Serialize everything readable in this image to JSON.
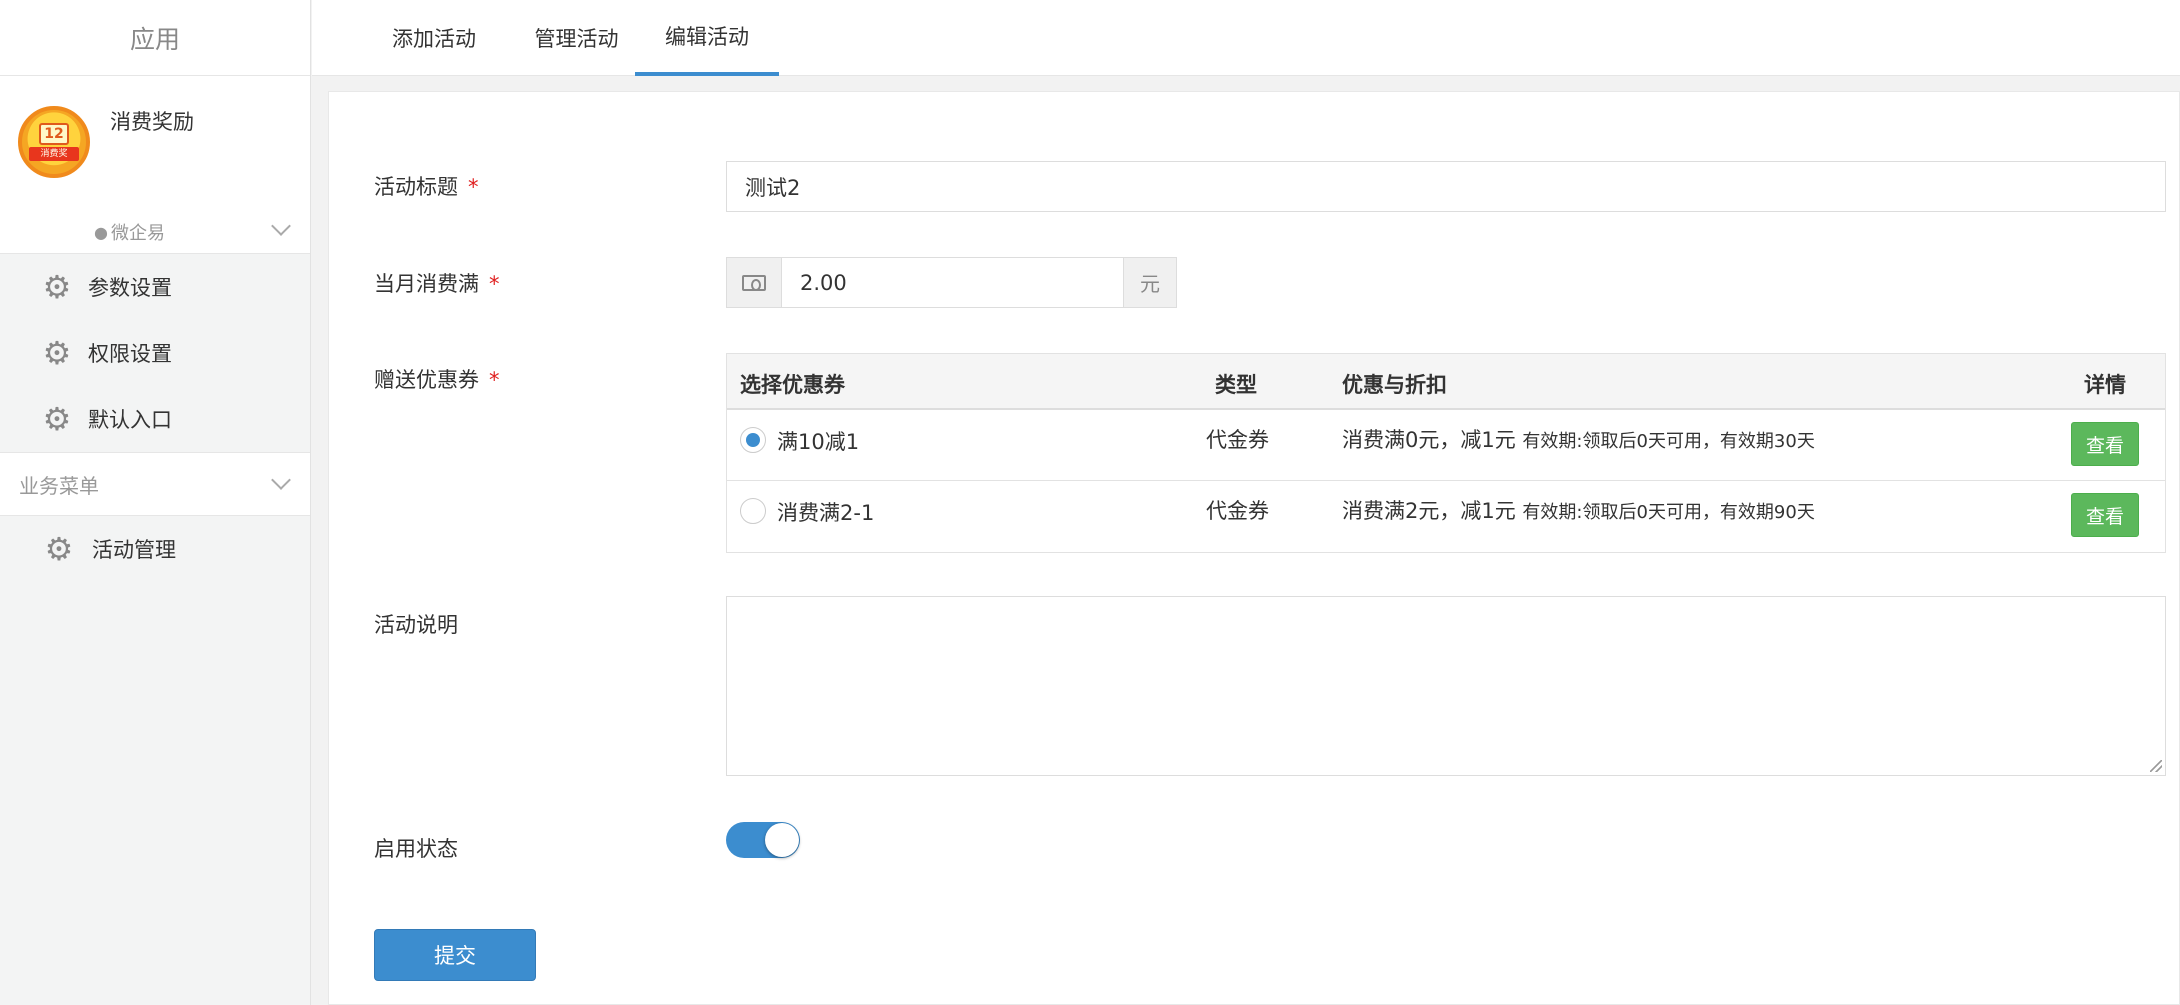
{
  "sidebar": {
    "header": "应用",
    "app_name": "消费奖励",
    "logo_badge": "12",
    "logo_text": "消费奖",
    "group_label": "微企易",
    "items": [
      {
        "label": "参数设置"
      },
      {
        "label": "权限设置"
      },
      {
        "label": "默认入口"
      }
    ],
    "section_label": "业务菜单",
    "section_items": [
      {
        "label": "活动管理"
      }
    ]
  },
  "tabs": [
    {
      "label": "添加活动",
      "active": false
    },
    {
      "label": "管理活动",
      "active": false
    },
    {
      "label": "编辑活动",
      "active": true
    }
  ],
  "form": {
    "title_label": "活动标题",
    "title_value": "测试2",
    "amount_label": "当月消费满",
    "amount_value": "2.00",
    "amount_unit": "元",
    "coupon_label": "赠送优惠券",
    "desc_label": "活动说明",
    "desc_value": "",
    "status_label": "启用状态",
    "status_on": true,
    "required_mark": "*",
    "submit_label": "提交"
  },
  "coupon_table": {
    "headers": {
      "select": "选择优惠券",
      "type": "类型",
      "discount": "优惠与折扣",
      "detail": "详情"
    },
    "rows": [
      {
        "name": "满10减1",
        "type": "代金券",
        "discount": "消费满0元，减1元",
        "validity": "有效期:领取后0天可用，有效期30天",
        "button": "查看",
        "selected": true
      },
      {
        "name": "消费满2-1",
        "type": "代金券",
        "discount": "消费满2元，减1元",
        "validity": "有效期:领取后0天可用，有效期90天",
        "button": "查看",
        "selected": false
      }
    ]
  },
  "colors": {
    "accent": "#3c8dcf",
    "view_button": "#5cb85c",
    "required": "#e02020"
  }
}
